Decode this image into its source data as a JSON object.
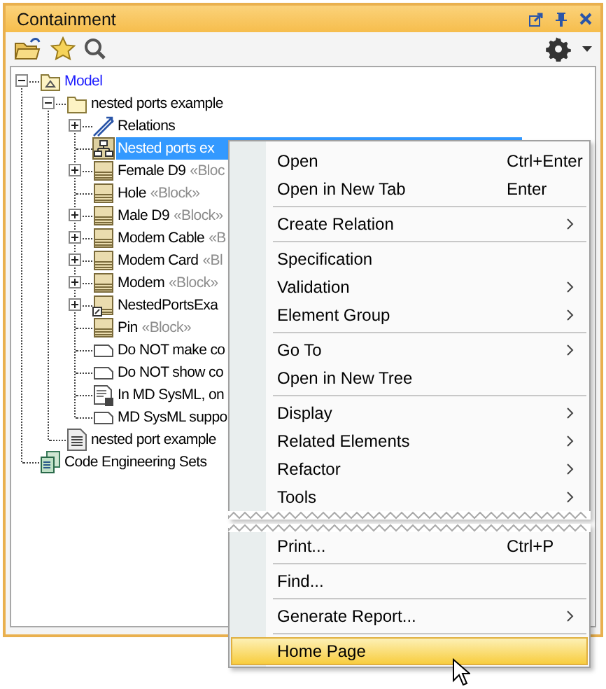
{
  "panel": {
    "title": "Containment"
  },
  "tree": [
    {
      "label": "Model",
      "kind": "model",
      "link": true,
      "expanded": true,
      "children": [
        {
          "label": "nested ports example",
          "kind": "package",
          "expanded": true,
          "children": [
            {
              "label": "Relations",
              "kind": "relations",
              "expanded": false
            },
            {
              "label": "Nested ports ex",
              "kind": "diagram",
              "selected": true
            },
            {
              "label": "Female D9",
              "stereotype": "«Bloc",
              "kind": "block",
              "expanded": false
            },
            {
              "label": "Hole",
              "stereotype": "«Block»",
              "kind": "block"
            },
            {
              "label": "Male D9",
              "stereotype": "«Block»",
              "kind": "block",
              "expanded": false
            },
            {
              "label": "Modem Cable",
              "stereotype": "«B",
              "kind": "block",
              "expanded": false
            },
            {
              "label": "Modem Card",
              "stereotype": "«Bl",
              "kind": "block",
              "expanded": false
            },
            {
              "label": "Modem",
              "stereotype": "«Block»",
              "kind": "block",
              "expanded": false
            },
            {
              "label": "NestedPortsExa",
              "kind": "system",
              "expanded": false
            },
            {
              "label": "Pin",
              "stereotype": "«Block»",
              "kind": "block"
            },
            {
              "label": "Do NOT make co",
              "kind": "note"
            },
            {
              "label": "Do NOT show co",
              "kind": "note"
            },
            {
              "label": "In MD SysML, on",
              "kind": "rule"
            },
            {
              "label": "MD SysML suppo",
              "kind": "note"
            }
          ]
        },
        {
          "label": "nested port example",
          "kind": "document"
        }
      ]
    },
    {
      "label": "Code Engineering Sets",
      "kind": "codesets"
    }
  ],
  "menu": {
    "upper": [
      [
        {
          "label": "Open",
          "shortcut": "Ctrl+Enter",
          "submenu": false,
          "selected": false
        },
        {
          "label": "Open in New Tab",
          "shortcut": "Enter",
          "submenu": false,
          "selected": false
        }
      ],
      [
        {
          "label": "Create Relation",
          "submenu": true,
          "selected": false
        }
      ],
      [
        {
          "label": "Specification",
          "submenu": false,
          "selected": false
        },
        {
          "label": "Validation",
          "submenu": true,
          "selected": false
        },
        {
          "label": "Element Group",
          "submenu": true,
          "selected": false
        }
      ],
      [
        {
          "label": "Go To",
          "submenu": true,
          "selected": false
        },
        {
          "label": "Open in New Tree",
          "submenu": false,
          "selected": false
        }
      ],
      [
        {
          "label": "Display",
          "submenu": true,
          "selected": false
        },
        {
          "label": "Related Elements",
          "submenu": true,
          "selected": false
        },
        {
          "label": "Refactor",
          "submenu": true,
          "selected": false
        },
        {
          "label": "Tools",
          "submenu": true,
          "selected": false
        }
      ]
    ],
    "lower": [
      [
        {
          "label": "Print...",
          "shortcut": "Ctrl+P",
          "submenu": false,
          "selected": false
        }
      ],
      [
        {
          "label": "Find...",
          "submenu": false,
          "selected": false
        }
      ],
      [
        {
          "label": "Generate Report...",
          "submenu": true,
          "selected": false
        }
      ],
      [
        {
          "label": "Home Page",
          "submenu": false,
          "selected": true
        }
      ]
    ]
  }
}
